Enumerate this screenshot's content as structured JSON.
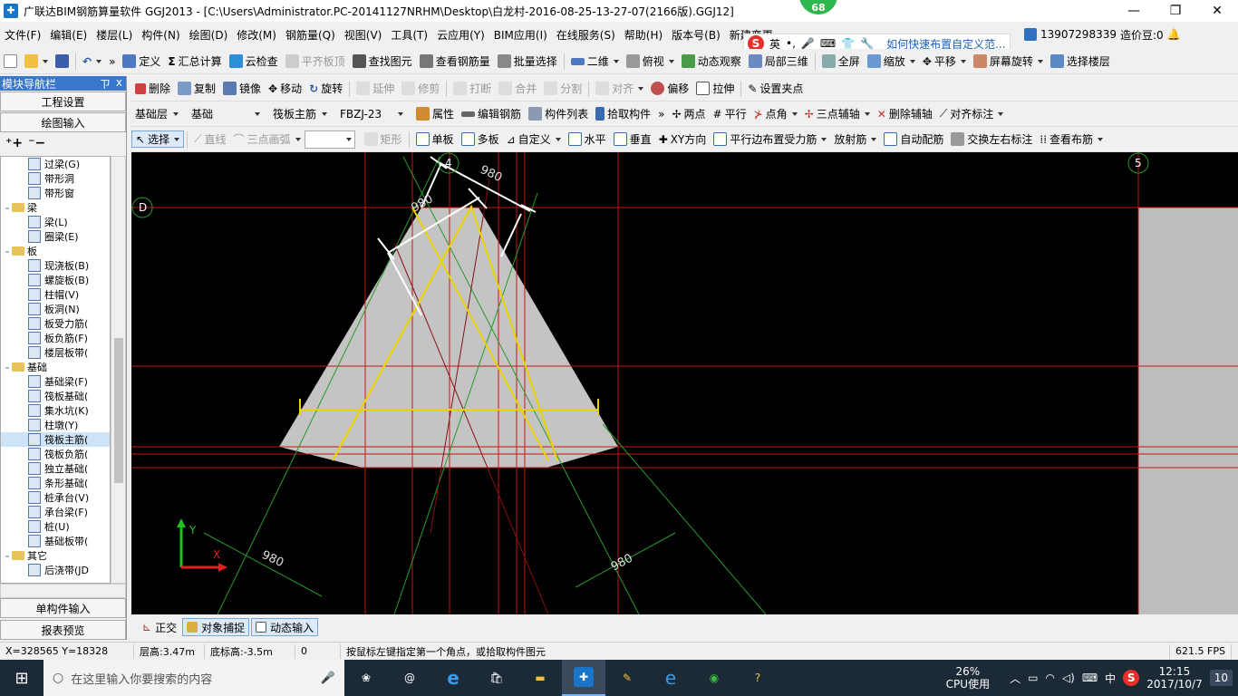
{
  "window": {
    "title": "广联达BIM钢筋算量软件 GGJ2013 - [C:\\Users\\Administrator.PC-20141127NRHM\\Desktop\\白龙村-2016-08-25-13-27-07(2166版).GGJ12]",
    "badge": "68"
  },
  "menu": {
    "items": [
      "文件(F)",
      "编辑(E)",
      "楼层(L)",
      "构件(N)",
      "绘图(D)",
      "修改(M)",
      "钢筋量(Q)",
      "视图(V)",
      "工具(T)",
      "云应用(Y)",
      "BIM应用(I)",
      "在线服务(S)",
      "帮助(H)",
      "版本号(B)",
      "新建变更"
    ],
    "ime_label": "英",
    "help_link": "如何快速布置自定义范...",
    "phone": "13907298339",
    "price": "造价豆:0"
  },
  "toolbar1": {
    "items": [
      "定义",
      "汇总计算",
      "云检查",
      "平齐板顶",
      "查找图元",
      "查看钢筋量",
      "批量选择",
      "二维",
      "俯视",
      "动态观察",
      "局部三维",
      "全屏",
      "缩放",
      "平移",
      "屏幕旋转",
      "选择楼层"
    ]
  },
  "toolbar2": {
    "items": [
      "删除",
      "复制",
      "镜像",
      "移动",
      "旋转",
      "延伸",
      "修剪",
      "打断",
      "合并",
      "分割",
      "对齐",
      "偏移",
      "拉伸",
      "设置夹点"
    ]
  },
  "toolbar3": {
    "combos": [
      "基础层",
      "基础",
      "筏板主筋",
      "FBZJ-23"
    ],
    "items": [
      "属性",
      "编辑钢筋",
      "构件列表",
      "拾取构件",
      "两点",
      "平行",
      "点角",
      "三点辅轴",
      "删除辅轴",
      "对齐标注"
    ]
  },
  "toolbar4": {
    "items": [
      "选择",
      "直线",
      "三点画弧",
      "矩形",
      "单板",
      "多板",
      "自定义",
      "水平",
      "垂直",
      "XY方向",
      "平行边布置受力筋",
      "放射筋",
      "自动配筋",
      "交换左右标注",
      "查看布筋"
    ]
  },
  "nav": {
    "title": "模块导航栏",
    "pin": "ㄗ",
    "close": "x",
    "section_settings": "工程设置",
    "section_draw": "绘图输入",
    "tree": [
      {
        "label": "过梁(G)",
        "level": 2
      },
      {
        "label": "带形洞",
        "level": 2
      },
      {
        "label": "带形窗",
        "level": 2
      },
      {
        "label": "梁",
        "level": 1,
        "folder": true
      },
      {
        "label": "梁(L)",
        "level": 2
      },
      {
        "label": "圈梁(E)",
        "level": 2
      },
      {
        "label": "板",
        "level": 1,
        "folder": true
      },
      {
        "label": "现浇板(B)",
        "level": 2
      },
      {
        "label": "螺旋板(B)",
        "level": 2
      },
      {
        "label": "柱帽(V)",
        "level": 2
      },
      {
        "label": "板洞(N)",
        "level": 2
      },
      {
        "label": "板受力筋(",
        "level": 2
      },
      {
        "label": "板负筋(F)",
        "level": 2
      },
      {
        "label": "楼层板带(",
        "level": 2
      },
      {
        "label": "基础",
        "level": 1,
        "folder": true
      },
      {
        "label": "基础梁(F)",
        "level": 2
      },
      {
        "label": "筏板基础(",
        "level": 2
      },
      {
        "label": "集水坑(K)",
        "level": 2
      },
      {
        "label": "柱墩(Y)",
        "level": 2
      },
      {
        "label": "筏板主筋(",
        "level": 2,
        "selected": true
      },
      {
        "label": "筏板负筋(",
        "level": 2
      },
      {
        "label": "独立基础(",
        "level": 2
      },
      {
        "label": "条形基础(",
        "level": 2
      },
      {
        "label": "桩承台(V)",
        "level": 2
      },
      {
        "label": "承台梁(F)",
        "level": 2
      },
      {
        "label": "桩(U)",
        "level": 2
      },
      {
        "label": "基础板带(",
        "level": 2
      },
      {
        "label": "其它",
        "level": 1,
        "folder": true
      },
      {
        "label": "后浇带(JD",
        "level": 2
      }
    ],
    "single_input": "单构件输入",
    "report": "报表预览"
  },
  "canvas": {
    "axis_d": "D",
    "axis_4": "4",
    "axis_5": "5",
    "dim_labels": [
      "980",
      "980",
      "980",
      "980"
    ],
    "y_label": "Y",
    "x_label": "X"
  },
  "drawbar": {
    "items": [
      "正交",
      "对象捕捉",
      "动态输入"
    ]
  },
  "status": {
    "coords": "X=328565 Y=18328",
    "floor_height": "层高:3.47m",
    "bottom_height": "底标高:-3.5m",
    "zero": "0",
    "hint": "按鼠标左键指定第一个角点，或拾取构件图元",
    "fps": "621.5 FPS"
  },
  "taskbar": {
    "search_placeholder": "在这里输入你要搜索的内容",
    "cpu_percent": "26%",
    "cpu_label": "CPU使用",
    "ime": "中",
    "time": "12:15",
    "date": "2017/10/7",
    "notif": "10"
  }
}
